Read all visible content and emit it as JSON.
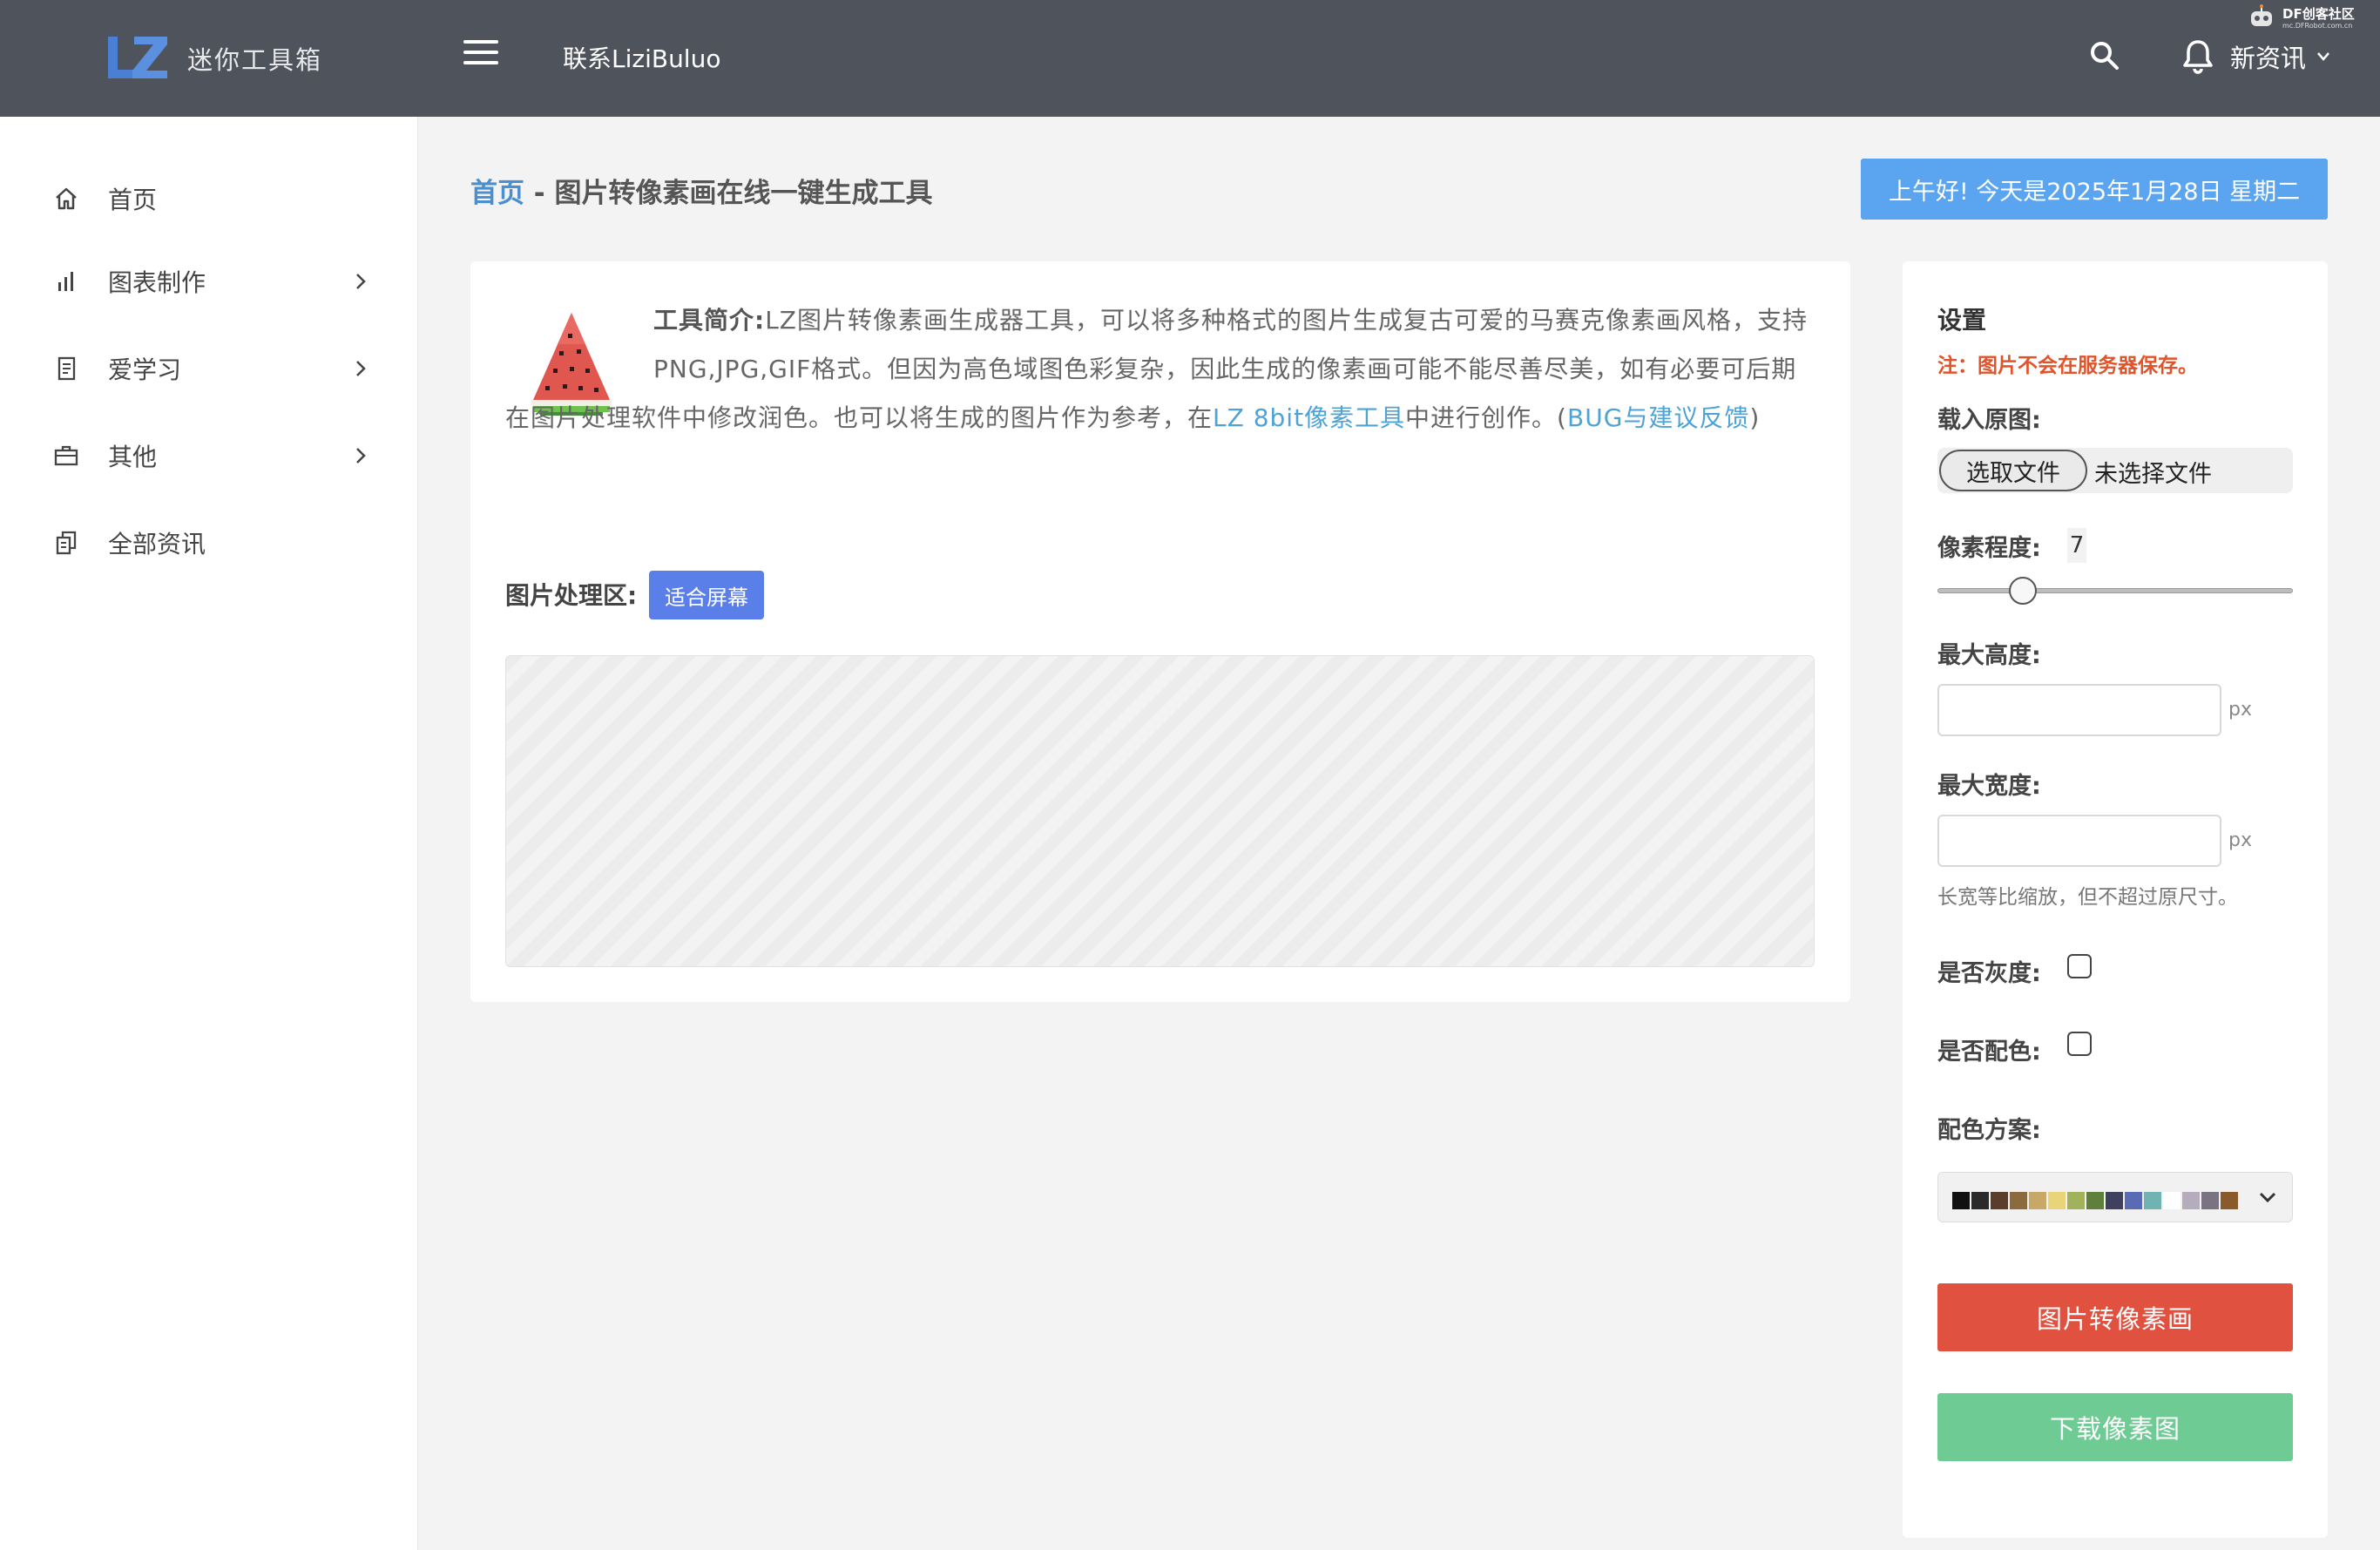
{
  "header": {
    "logo_text": "迷你工具箱",
    "contact_link": "联系LiziBuluo",
    "news_label": "新资讯",
    "watermark": {
      "title": "DF创客社区",
      "subtitle": "mc.DFRobot.com.cn"
    }
  },
  "sidebar": {
    "items": [
      {
        "label": "首页",
        "icon": "home-icon",
        "has_children": false
      },
      {
        "label": "图表制作",
        "icon": "bar-chart-icon",
        "has_children": true
      },
      {
        "label": "爱学习",
        "icon": "document-icon",
        "has_children": true
      },
      {
        "label": "其他",
        "icon": "briefcase-icon",
        "has_children": true
      },
      {
        "label": "全部资讯",
        "icon": "copy-icon",
        "has_children": false
      }
    ]
  },
  "breadcrumb": {
    "home": "首页",
    "separator": " - ",
    "current": "图片转像素画在线一键生成工具"
  },
  "greeting": "上午好! 今天是2025年1月28日  星期二",
  "intro": {
    "title": "工具简介:",
    "text1": "LZ图片转像素画生成器工具，可以将多种格式的图片生成复古可爱的马赛克像素画风格，支持PNG,JPG,GIF格式。但因为高色域图色彩复杂，因此生成的像素画可能不能尽善尽美，如有必要可后期在图片处理软件中修改润色。也可以将生成的图片作为参考，在",
    "link1": "LZ 8bit像素工具",
    "text2": "中进行创作。(",
    "link2": "BUG与建议反馈",
    "text3": ")"
  },
  "workspace": {
    "label": "图片处理区:",
    "fit_button": "适合屏幕"
  },
  "settings": {
    "title": "设置",
    "note": "注：图片不会在服务器保存。",
    "load_label": "载入原图:",
    "file_button": "选取文件",
    "file_status": "未选择文件",
    "pixel_label": "像素程度:",
    "pixel_value": "7",
    "pixel_fraction": 0.24,
    "max_height_label": "最大高度:",
    "max_height_value": "",
    "max_width_label": "最大宽度:",
    "max_width_value": "",
    "unit": "px",
    "ratio_hint": "长宽等比缩放，但不超过原尺寸。",
    "grayscale_label": "是否灰度:",
    "grayscale_checked": false,
    "palette_enable_label": "是否配色:",
    "palette_enable_checked": false,
    "palette_label": "配色方案:",
    "palette_colors": [
      "#111111",
      "#2a2a2a",
      "#5a3e2b",
      "#8b6a3e",
      "#c8a867",
      "#e8d57a",
      "#a0b35a",
      "#5f7f3c",
      "#3f3f5f",
      "#5a6bb5",
      "#6fb3b3",
      "#ffffff",
      "#b5adbd",
      "#7a7382",
      "#8a5a2b"
    ],
    "convert_button": "图片转像素画",
    "download_button": "下载像素图"
  },
  "colors": {
    "header_bg": "#4f535b",
    "accent_blue": "#5aa4f0",
    "danger": "#e05140",
    "success": "#6fcb94",
    "link": "#4ea3d6"
  }
}
